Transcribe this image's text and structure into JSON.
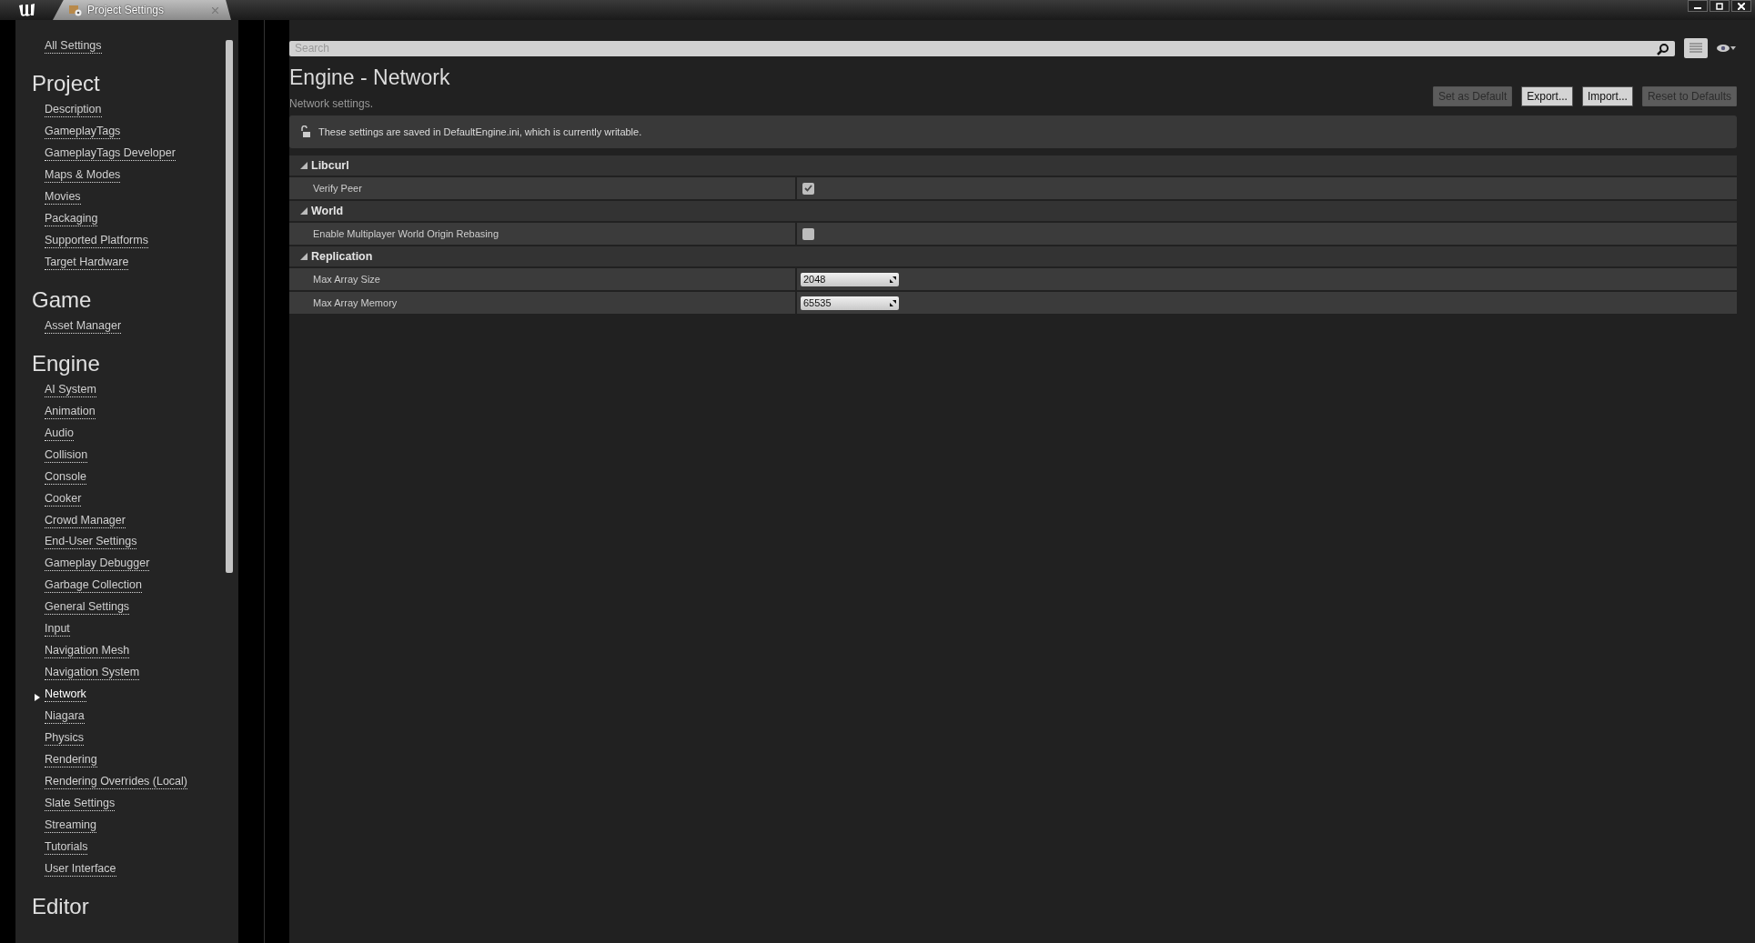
{
  "window": {
    "tab_title": "Project Settings"
  },
  "sidebar": {
    "all_settings": "All Settings",
    "sections": [
      {
        "title": "Project",
        "items": [
          {
            "label": "Description",
            "selected": false
          },
          {
            "label": "GameplayTags",
            "selected": false
          },
          {
            "label": "GameplayTags Developer",
            "selected": false
          },
          {
            "label": "Maps & Modes",
            "selected": false
          },
          {
            "label": "Movies",
            "selected": false
          },
          {
            "label": "Packaging",
            "selected": false
          },
          {
            "label": "Supported Platforms",
            "selected": false
          },
          {
            "label": "Target Hardware",
            "selected": false
          }
        ]
      },
      {
        "title": "Game",
        "items": [
          {
            "label": "Asset Manager",
            "selected": false
          }
        ]
      },
      {
        "title": "Engine",
        "items": [
          {
            "label": "AI System",
            "selected": false
          },
          {
            "label": "Animation",
            "selected": false
          },
          {
            "label": "Audio",
            "selected": false
          },
          {
            "label": "Collision",
            "selected": false
          },
          {
            "label": "Console",
            "selected": false
          },
          {
            "label": "Cooker",
            "selected": false
          },
          {
            "label": "Crowd Manager",
            "selected": false
          },
          {
            "label": "End-User Settings",
            "selected": false
          },
          {
            "label": "Gameplay Debugger",
            "selected": false
          },
          {
            "label": "Garbage Collection",
            "selected": false
          },
          {
            "label": "General Settings",
            "selected": false
          },
          {
            "label": "Input",
            "selected": false
          },
          {
            "label": "Navigation Mesh",
            "selected": false
          },
          {
            "label": "Navigation System",
            "selected": false
          },
          {
            "label": "Network",
            "selected": true
          },
          {
            "label": "Niagara",
            "selected": false
          },
          {
            "label": "Physics",
            "selected": false
          },
          {
            "label": "Rendering",
            "selected": false
          },
          {
            "label": "Rendering Overrides (Local)",
            "selected": false
          },
          {
            "label": "Slate Settings",
            "selected": false
          },
          {
            "label": "Streaming",
            "selected": false
          },
          {
            "label": "Tutorials",
            "selected": false
          },
          {
            "label": "User Interface",
            "selected": false
          }
        ]
      },
      {
        "title": "Editor"
      }
    ]
  },
  "search": {
    "placeholder": "Search"
  },
  "page": {
    "title": "Engine - Network",
    "subtitle": "Network settings.",
    "buttons": [
      {
        "label": "Set as Default",
        "disabled": true
      },
      {
        "label": "Export...",
        "disabled": false
      },
      {
        "label": "Import...",
        "disabled": false
      },
      {
        "label": "Reset to Defaults",
        "disabled": true
      }
    ],
    "notice": "These settings are saved in DefaultEngine.ini, which is currently writable."
  },
  "categories": [
    {
      "title": "Libcurl",
      "expanded": true,
      "rows": [
        {
          "label": "Verify Peer",
          "kind": "checkbox",
          "checked": true
        }
      ]
    },
    {
      "title": "World",
      "expanded": true,
      "rows": [
        {
          "label": "Enable Multiplayer World Origin Rebasing",
          "kind": "checkbox",
          "checked": false
        }
      ]
    },
    {
      "title": "Replication",
      "expanded": true,
      "rows": [
        {
          "label": "Max Array Size",
          "kind": "number",
          "value": "2048"
        },
        {
          "label": "Max Array Memory",
          "kind": "number",
          "value": "65535"
        }
      ]
    }
  ]
}
